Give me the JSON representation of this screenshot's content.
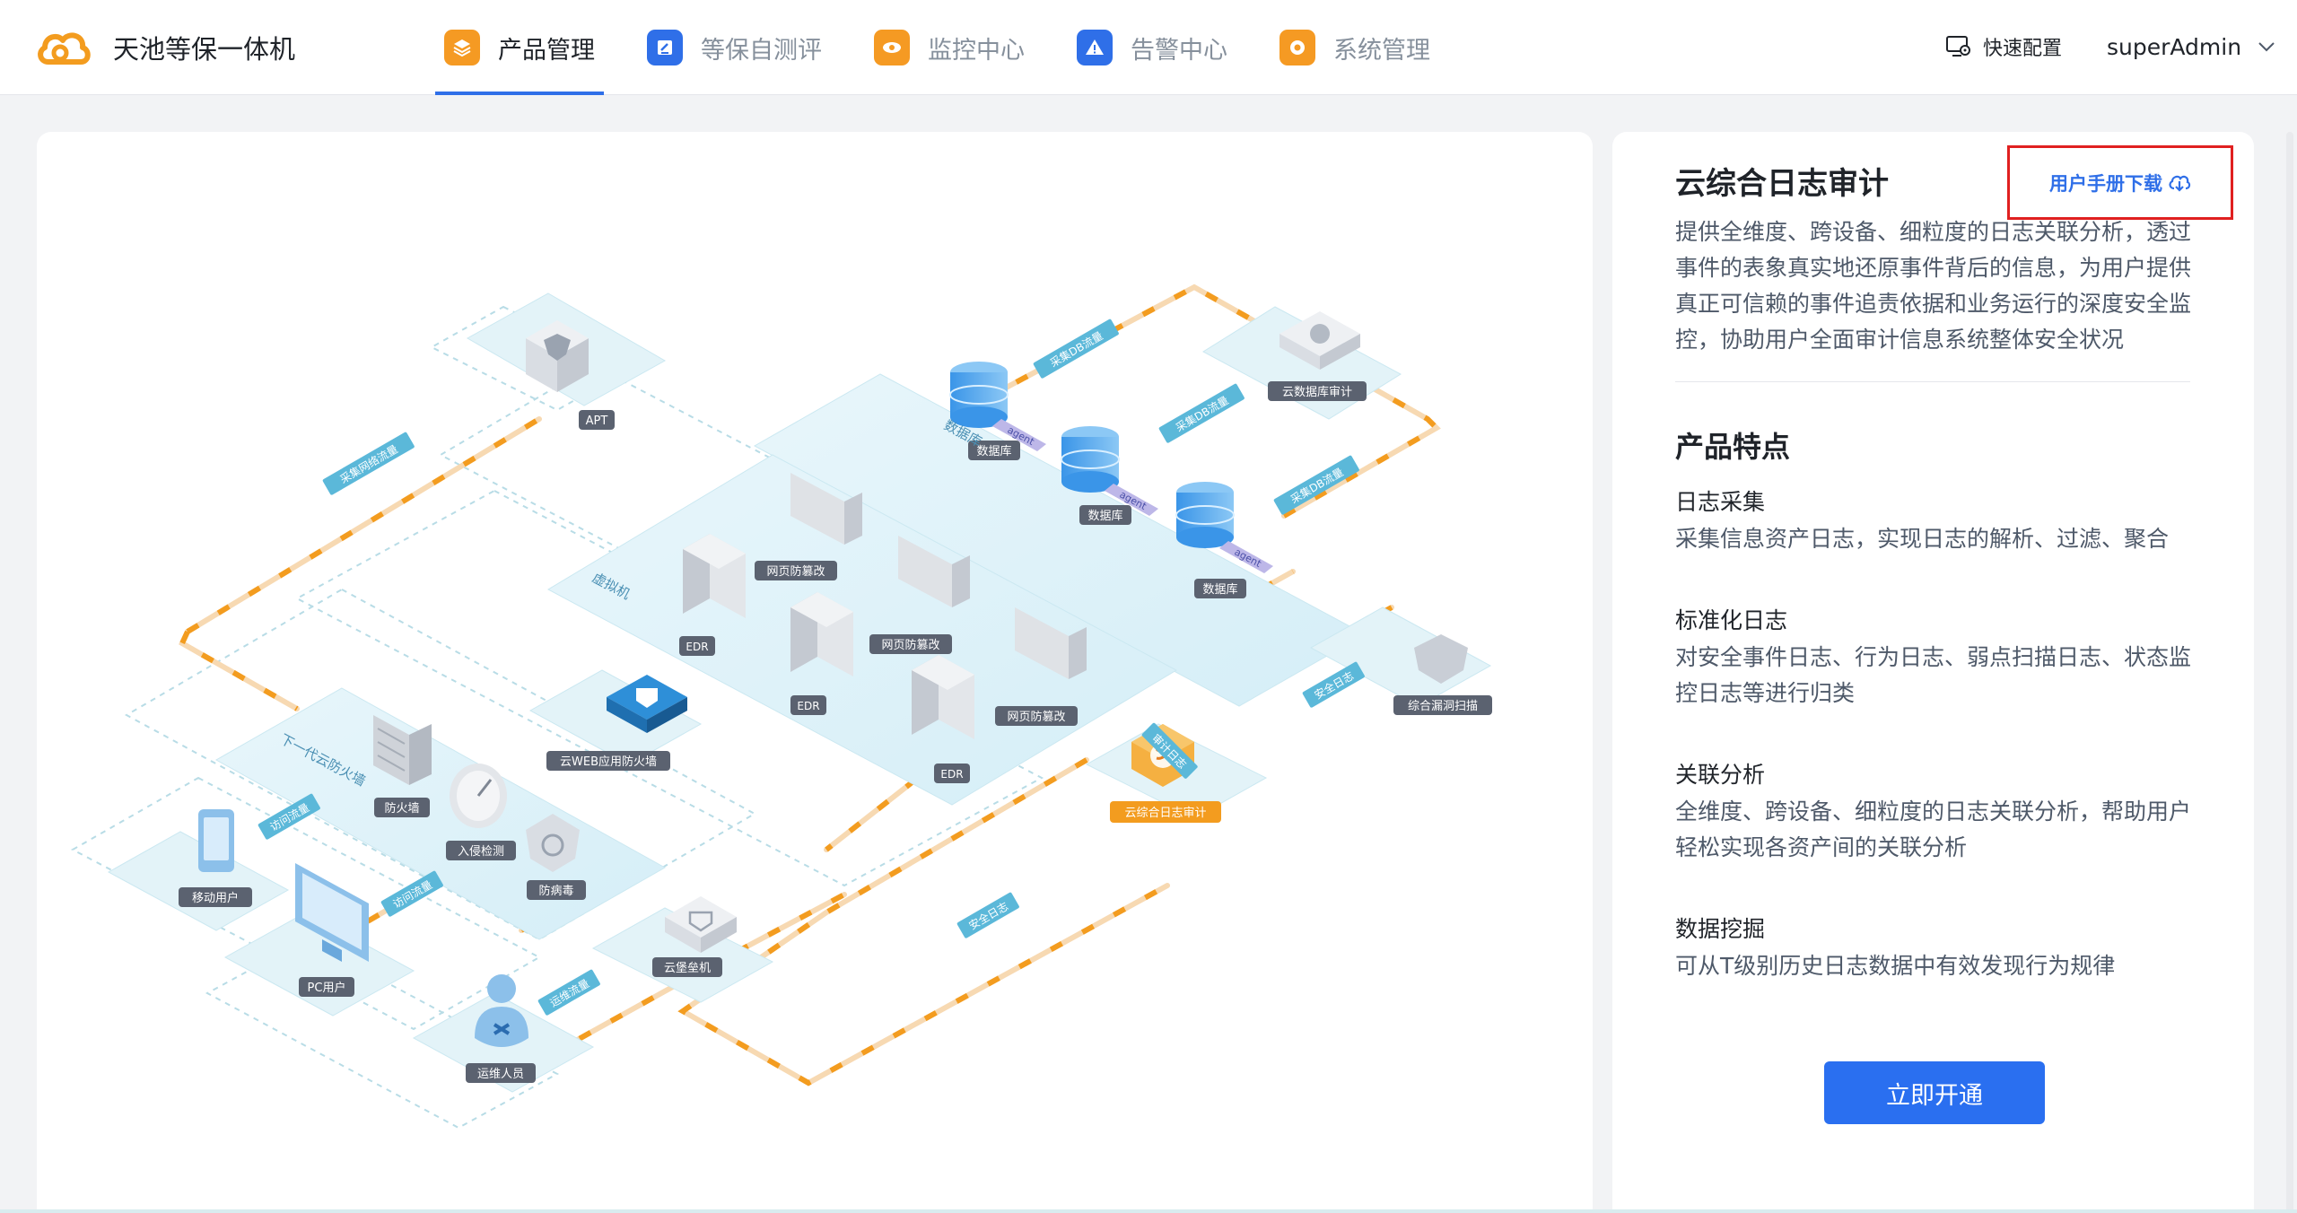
{
  "app": {
    "title": "天池等保一体机"
  },
  "nav": {
    "items": [
      {
        "label": "产品管理",
        "active": true,
        "color": "#f59a23"
      },
      {
        "label": "等保自测评",
        "active": false,
        "color": "#2f6fe8"
      },
      {
        "label": "监控中心",
        "active": false,
        "color": "#f59a23"
      },
      {
        "label": "告警中心",
        "active": false,
        "color": "#2f6fe8"
      },
      {
        "label": "系统管理",
        "active": false,
        "color": "#f59a23"
      }
    ]
  },
  "header": {
    "quick_config": "快速配置",
    "username": "superAdmin"
  },
  "diagram": {
    "labels": {
      "apt": "APT",
      "db_group": "数据库",
      "cloud_db_audit": "云数据库审计",
      "db1": "数据库",
      "db2": "数据库",
      "db3": "数据库",
      "vm_group": "虚拟机",
      "edr1": "EDR",
      "edr2": "EDR",
      "edr3": "EDR",
      "web_tamper1": "网页防篡改",
      "web_tamper2": "网页防篡改",
      "web_tamper3": "网页防篡改",
      "vuln_scan": "综合漏洞扫描",
      "log_audit": "云综合日志审计",
      "ngfw_group": "下一代云防火墙",
      "waf": "云WEB应用防火墙",
      "firewall": "防火墙",
      "ids": "入侵检测",
      "antivirus": "防病毒",
      "mobile_user": "移动用户",
      "pc_user": "PC用户",
      "ops_staff": "运维人员",
      "bastion": "云堡垒机",
      "agent": "agent"
    },
    "flows": {
      "collect_traffic": "采集网络流量",
      "collect_db1": "采集DB流量",
      "collect_db2": "采集DB流量",
      "collect_db3": "采集DB流量",
      "access1": "访问流量",
      "access2": "访问流量",
      "ops_traffic": "运维流量",
      "sec_log1": "安全日志",
      "sec_log2": "安全日志",
      "audit_log": "审计日志"
    }
  },
  "product": {
    "title": "云综合日志审计",
    "manual_link": "用户手册下载",
    "description": "提供全维度、跨设备、细粒度的日志关联分析，透过事件的表象真实地还原事件背后的信息，为用户提供真正可信赖的事件追责依据和业务运行的深度安全监控，协助用户全面审计信息系统整体安全状况",
    "features_title": "产品特点",
    "features": [
      {
        "name": "日志采集",
        "desc": "采集信息资产日志，实现日志的解析、过滤、聚合"
      },
      {
        "name": "标准化日志",
        "desc": "对安全事件日志、行为日志、弱点扫描日志、状态监控日志等进行归类"
      },
      {
        "name": "关联分析",
        "desc": "全维度、跨设备、细粒度的日志关联分析，帮助用户轻松实现各资产间的关联分析"
      },
      {
        "name": "数据挖掘",
        "desc": "可从T级别历史日志数据中有效发现行为规律"
      }
    ],
    "activate_button": "立即开通"
  }
}
